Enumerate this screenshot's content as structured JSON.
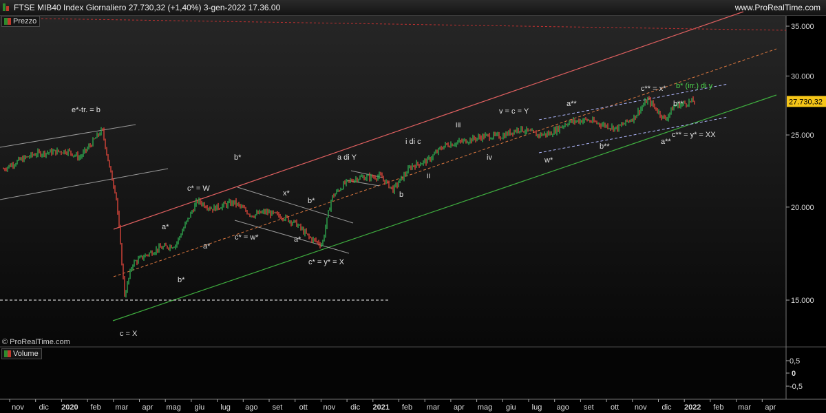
{
  "header": {
    "title": "FTSE MIB40 Index Giornaliero 27.730,32 (+1,40%) 3-gen-2022 17.36.00",
    "brand": "www.ProRealTime.com"
  },
  "panes": {
    "price_label": "Prezzo",
    "volume_label": "Volume",
    "copyright": "© ProRealTime.com"
  },
  "colors": {
    "up": "#2fa84f",
    "down": "#d8453a",
    "upper_channel": "#e06060",
    "lower_channel": "#3fae3f",
    "mid_channel": "#e07a40",
    "grey_lines": "#9a9a9a",
    "dashed_white": "#ffffff",
    "dashed_blue": "#b0b8ff",
    "top_dashed_red": "#c03030",
    "last_price_bg": "#f5c518"
  },
  "chart_data": {
    "type": "line",
    "title": "FTSE MIB40 Index Giornaliero",
    "scale": "log",
    "ylim": [
      13000,
      36500
    ],
    "y_ticks": [
      "35.000",
      "30.000",
      "25.000",
      "20.000",
      "15.000"
    ],
    "last_price_label": "27.730,32",
    "x_ticks": [
      "nov",
      "dic",
      "2020",
      "feb",
      "mar",
      "apr",
      "mag",
      "giu",
      "lug",
      "ago",
      "set",
      "ott",
      "nov",
      "dic",
      "2021",
      "feb",
      "mar",
      "apr",
      "mag",
      "giu",
      "lug",
      "ago",
      "set",
      "ott",
      "nov",
      "dic",
      "2022",
      "feb",
      "mar",
      "apr"
    ],
    "series": [
      {
        "dates": [
          "2019-10-28",
          "2019-11-15",
          "2019-12-05",
          "2019-12-20",
          "2020-01-10",
          "2020-01-24",
          "2020-02-05",
          "2020-02-19",
          "2020-02-28",
          "2020-03-06",
          "2020-03-12",
          "2020-03-16",
          "2020-03-25",
          "2020-04-08",
          "2020-04-24",
          "2020-05-14",
          "2020-06-08",
          "2020-06-25",
          "2020-07-20",
          "2020-08-10",
          "2020-08-25",
          "2020-09-15",
          "2020-09-30",
          "2020-10-15",
          "2020-10-30",
          "2020-11-10",
          "2020-11-25",
          "2020-12-10",
          "2021-01-05",
          "2021-01-20",
          "2021-02-10",
          "2021-03-01",
          "2021-03-20",
          "2021-04-10",
          "2021-05-05",
          "2021-05-25",
          "2021-06-15",
          "2021-07-05",
          "2021-07-20",
          "2021-08-10",
          "2021-08-30",
          "2021-09-20",
          "2021-10-05",
          "2021-10-25",
          "2021-11-10",
          "2021-11-30",
          "2021-12-10",
          "2021-12-31"
        ],
        "close": [
          22500,
          23100,
          23600,
          23700,
          23800,
          23300,
          24200,
          25400,
          22400,
          20800,
          17200,
          15200,
          16800,
          17200,
          17600,
          17800,
          20400,
          19900,
          20300,
          19500,
          19700,
          19400,
          19000,
          18200,
          17800,
          20600,
          21500,
          21900,
          22000,
          21100,
          22700,
          23100,
          24200,
          24500,
          24900,
          24900,
          25500,
          25000,
          25100,
          26000,
          26200,
          25800,
          25500,
          26400,
          27900,
          26200,
          27300,
          27730
        ]
      }
    ]
  },
  "annotations": [
    {
      "text": "e*-tr. = b",
      "color": "#e0e0e0"
    },
    {
      "text": "c = X",
      "color": "#e0e0e0"
    },
    {
      "text": "a*",
      "color": "#e0e0e0"
    },
    {
      "text": "b*",
      "color": "#e0e0e0"
    },
    {
      "text": "c* = W",
      "color": "#e0e0e0"
    },
    {
      "text": "a*",
      "color": "#e0e0e0"
    },
    {
      "text": "b*",
      "color": "#e0e0e0"
    },
    {
      "text": "c* = w*",
      "color": "#e0e0e0"
    },
    {
      "text": "x*",
      "color": "#e0e0e0"
    },
    {
      "text": "b*",
      "color": "#e0e0e0"
    },
    {
      "text": "a*",
      "color": "#e0e0e0"
    },
    {
      "text": "c* = y* = X",
      "color": "#e0e0e0"
    },
    {
      "text": "a di Y",
      "color": "#e0e0e0"
    },
    {
      "text": "b",
      "color": "#e0e0e0"
    },
    {
      "text": "i di c",
      "color": "#e0e0e0"
    },
    {
      "text": "ii",
      "color": "#e0e0e0"
    },
    {
      "text": "iii",
      "color": "#e0e0e0"
    },
    {
      "text": "iv",
      "color": "#e0e0e0"
    },
    {
      "text": "v = c = Y",
      "color": "#e0e0e0"
    },
    {
      "text": "w*",
      "color": "#e0e0e0"
    },
    {
      "text": "a**",
      "color": "#e0e0e0"
    },
    {
      "text": "b**",
      "color": "#e0e0e0"
    },
    {
      "text": "c** = x*",
      "color": "#e0e0e0"
    },
    {
      "text": "b* (irr.) di y",
      "color": "#4cd44c"
    },
    {
      "text": "b**",
      "color": "#e0e0e0"
    },
    {
      "text": "a**",
      "color": "#e0e0e0"
    },
    {
      "text": "c** = y* = XX",
      "color": "#e0e0e0"
    }
  ],
  "volume_axis": {
    "ticks": [
      "0,5",
      "0",
      "-0,5"
    ]
  }
}
